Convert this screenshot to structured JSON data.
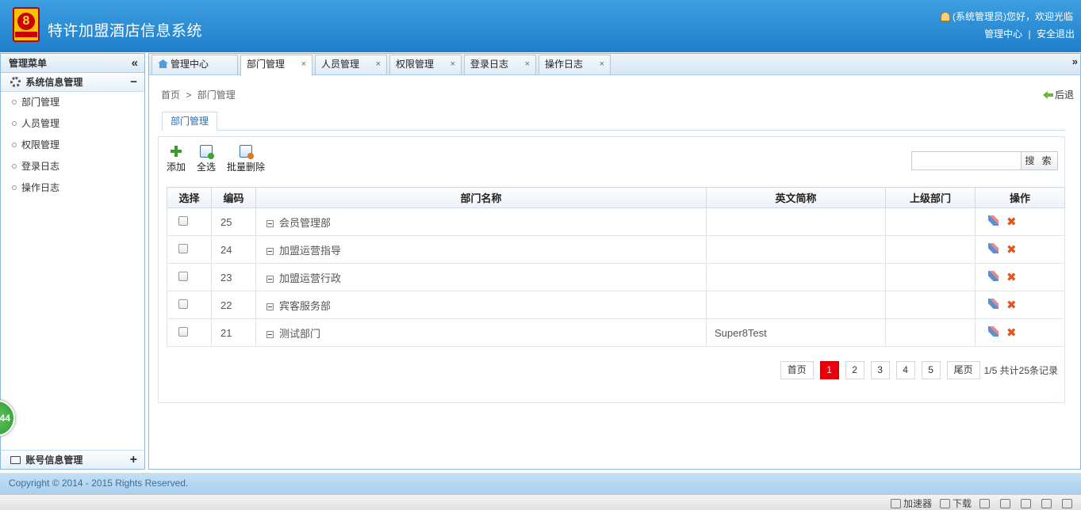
{
  "header": {
    "title": "特许加盟酒店信息系统",
    "greeting": "(系统管理员)您好，欢迎光临",
    "admin_center": "管理中心",
    "logout": "安全退出",
    "link_sep": "|"
  },
  "logo": {
    "number": "8"
  },
  "sidebar": {
    "title": "管理菜单",
    "collapse_glyph": "«",
    "group1": {
      "label": "系统信息管理",
      "toggle": "−"
    },
    "items": [
      {
        "label": "部门管理"
      },
      {
        "label": "人员管理"
      },
      {
        "label": "权限管理"
      },
      {
        "label": "登录日志"
      },
      {
        "label": "操作日志"
      }
    ],
    "group2": {
      "label": "账号信息管理",
      "toggle": "+"
    },
    "badge": "44"
  },
  "tabs": [
    {
      "label": "管理中心"
    },
    {
      "label": "部门管理"
    },
    {
      "label": "人员管理"
    },
    {
      "label": "权限管理"
    },
    {
      "label": "登录日志"
    },
    {
      "label": "操作日志"
    }
  ],
  "tab_close_glyph": "×",
  "tab_more_glyph": "»",
  "breadcrumb": {
    "home": "首页",
    "sep": ">",
    "current": "部门管理"
  },
  "back_label": "后退",
  "subtab_label": "部门管理",
  "toolbar": {
    "add": "添加",
    "select_all": "全选",
    "batch_delete": "批量删除"
  },
  "search": {
    "button": "搜 索",
    "value": ""
  },
  "table": {
    "headers": {
      "select": "选择",
      "code": "编码",
      "name": "部门名称",
      "en": "英文简称",
      "parent": "上级部门",
      "ops": "操作"
    },
    "rows": [
      {
        "code": "25",
        "name": "会员管理部",
        "en": "",
        "parent": ""
      },
      {
        "code": "24",
        "name": "加盟运营指导",
        "en": "",
        "parent": ""
      },
      {
        "code": "23",
        "name": "加盟运营行政",
        "en": "",
        "parent": ""
      },
      {
        "code": "22",
        "name": "宾客服务部",
        "en": "",
        "parent": ""
      },
      {
        "code": "21",
        "name": "测试部门",
        "en": "Super8Test",
        "parent": ""
      }
    ],
    "delete_glyph": "✖"
  },
  "pager": {
    "first": "首页",
    "pages": [
      "1",
      "2",
      "3",
      "4",
      "5"
    ],
    "current_page": "1",
    "last": "尾页",
    "info": "1/5 共计25条记录"
  },
  "footer": {
    "copyright": "Copyright © 2014 - 2015 Rights Reserved."
  },
  "statusbar": {
    "accelerator": "加速器",
    "download": "下载"
  },
  "colors": {
    "header_blue": "#2a8ad6",
    "pager_current": "#e8000c",
    "delete_orange": "#e2541c",
    "add_green": "#3a9a2a"
  }
}
